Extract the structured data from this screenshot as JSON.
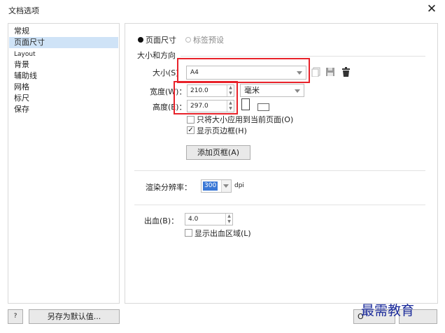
{
  "window": {
    "title": "文档选项",
    "close_glyph": "✕"
  },
  "sidebar": {
    "items": [
      {
        "label": "常规"
      },
      {
        "label": "页面尺寸"
      },
      {
        "label": "Layout"
      },
      {
        "label": "背景"
      },
      {
        "label": "辅助线"
      },
      {
        "label": "网格"
      },
      {
        "label": "标尺"
      },
      {
        "label": "保存"
      }
    ],
    "selected": "页面尺寸"
  },
  "mode": {
    "page_size": "页面尺寸",
    "label_preset": "标签预设",
    "selected": "页面尺寸"
  },
  "size_orientation": {
    "section_title": "大小和方向",
    "size_label": "大小(S)",
    "size_value": "A4",
    "width_label": "宽度(W)：",
    "width_value": "210.0",
    "height_label": "高度(E)：",
    "height_value": "297.0",
    "unit_value": "毫米",
    "apply_current_only": {
      "label": "只将大小应用到当前页面(O)",
      "checked": false
    },
    "show_page_border": {
      "label": "显示页边框(H)",
      "checked": true
    },
    "add_page_frame_button": "添加页框(A)",
    "orientation": "portrait"
  },
  "render": {
    "label": "渲染分辨率：",
    "value": "300",
    "unit": "dpi"
  },
  "bleed": {
    "label": "出血(B)：",
    "value": "4.0",
    "show_bleed": {
      "label": "显示出血区域(L)",
      "checked": false
    }
  },
  "footer": {
    "help_button": "?",
    "save_default_button": "另存为默认值...",
    "ok_button_fragment": "O"
  },
  "watermark": {
    "text": "最需教育"
  },
  "colors": {
    "selection": "#cfe3f7",
    "highlight_box": "#e8222a",
    "watermark": "#1a2a9a"
  },
  "icons": [
    "close-icon",
    "copy-icon",
    "save-icon",
    "trash-icon",
    "portrait-icon",
    "landscape-icon"
  ]
}
